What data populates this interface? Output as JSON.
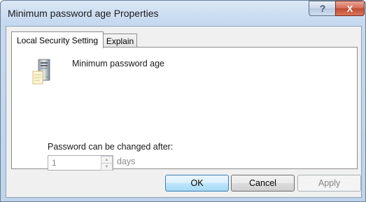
{
  "window": {
    "title": "Minimum password age Properties",
    "help_glyph": "?",
    "close_glyph": "X"
  },
  "tabs": [
    {
      "label": "Local Security Setting",
      "active": true
    },
    {
      "label": "Explain",
      "active": false
    }
  ],
  "policy": {
    "icon": "server-policy-icon",
    "name": "Minimum password age"
  },
  "setting": {
    "label": "Password can be changed after:",
    "value": "1",
    "unit": "days",
    "spin_up_glyph": "▲",
    "spin_down_glyph": "▼"
  },
  "buttons": {
    "ok": "OK",
    "cancel": "Cancel",
    "apply": "Apply"
  },
  "colors": {
    "accent": "#3c7fb1",
    "disabled_text": "#838383",
    "close_red": "#c14a30"
  }
}
